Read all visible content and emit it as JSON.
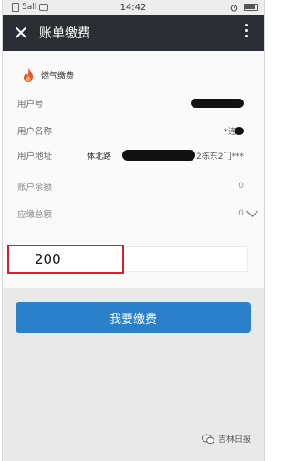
{
  "status": {
    "carrier": "5all",
    "time": "14:42"
  },
  "header": {
    "title": "账单缴费"
  },
  "brand": {
    "name": "燃气缴费"
  },
  "info": {
    "user_no_label": "用户号",
    "user_name_label": "用户名称",
    "user_name_value": "*连",
    "address_label": "用户地址",
    "address_value_left": "体北路",
    "address_value_right": "2栋东2门***",
    "balance_label": "账户余额",
    "balance_value": "0",
    "due_label": "应缴总额",
    "due_value": "0"
  },
  "amount": {
    "value": "200"
  },
  "button": {
    "pay_label": "我要缴费"
  },
  "watermark": {
    "text": "吉林日报"
  },
  "colors": {
    "header_bg": "#2a2d33",
    "button_bg": "#2a80c9",
    "highlight_border": "#d9202a",
    "flame": "#e8563a"
  }
}
